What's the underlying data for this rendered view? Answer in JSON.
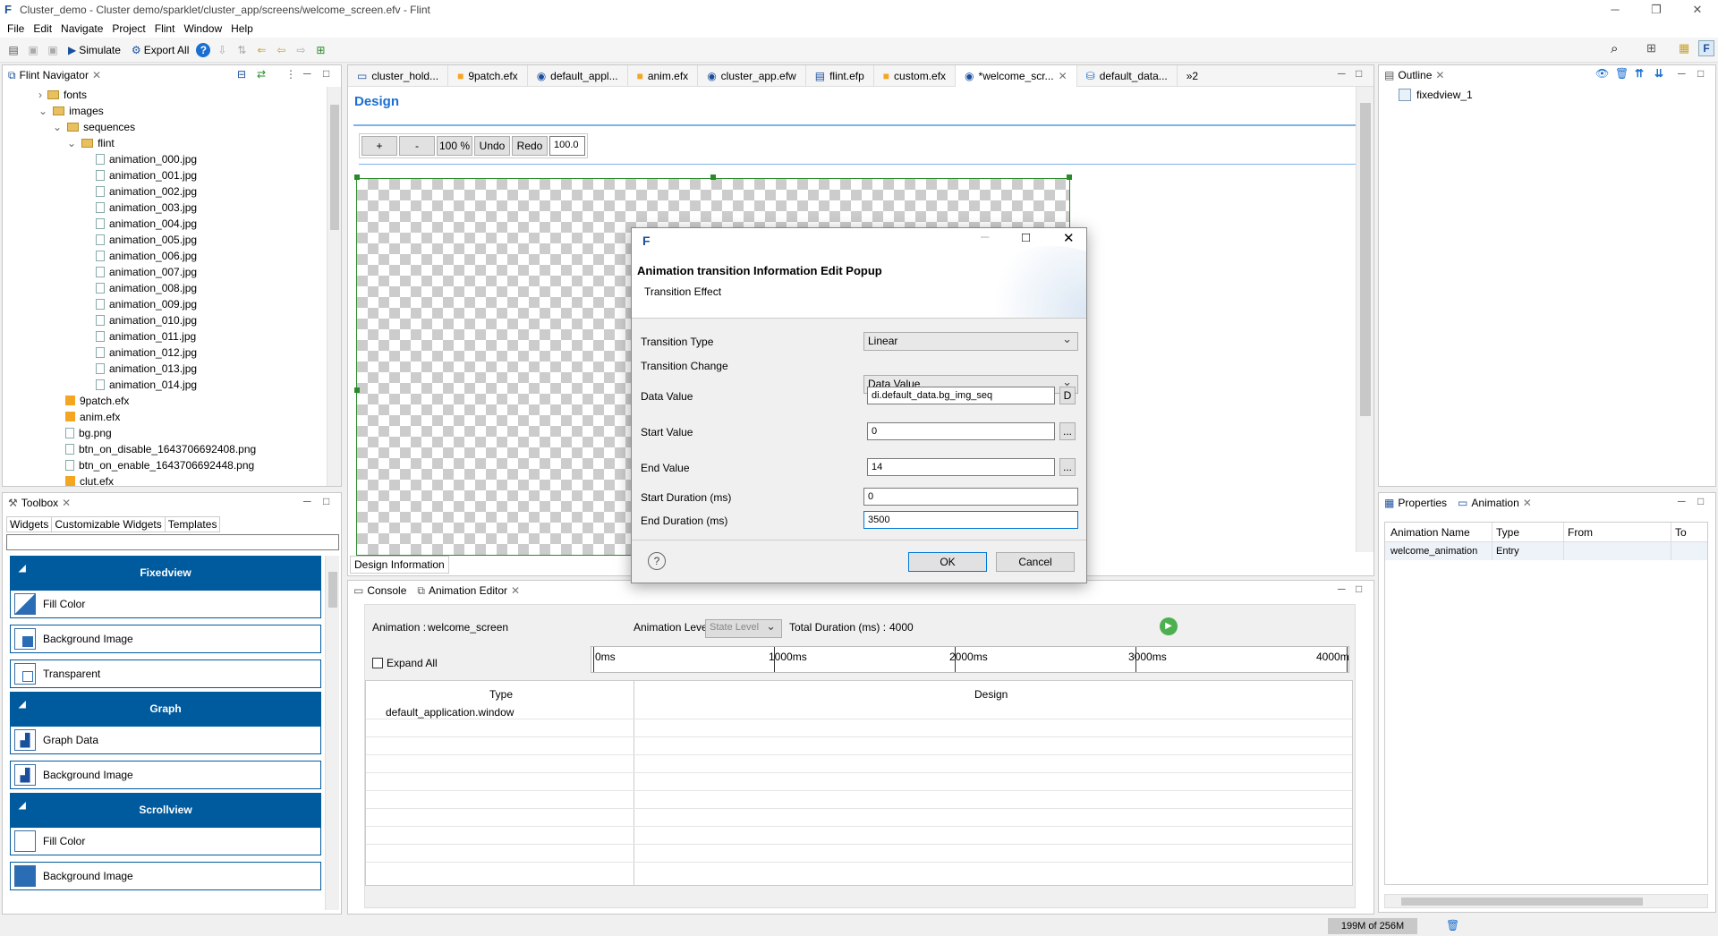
{
  "window": {
    "title": "Cluster_demo - Cluster demo/sparklet/cluster_app/screens/welcome_screen.efv - Flint",
    "app_icon": "F"
  },
  "menu": [
    "File",
    "Edit",
    "Navigate",
    "Project",
    "Flint",
    "Window",
    "Help"
  ],
  "toolbar": {
    "simulate": "Simulate",
    "export_all": "Export All"
  },
  "navigator": {
    "tab": "Flint Navigator",
    "folders": {
      "fonts": "fonts",
      "images": "images",
      "sequences": "sequences",
      "flint": "flint"
    },
    "anim_files": [
      "animation_000.jpg",
      "animation_001.jpg",
      "animation_002.jpg",
      "animation_003.jpg",
      "animation_004.jpg",
      "animation_005.jpg",
      "animation_006.jpg",
      "animation_007.jpg",
      "animation_008.jpg",
      "animation_009.jpg",
      "animation_010.jpg",
      "animation_011.jpg",
      "animation_012.jpg",
      "animation_013.jpg",
      "animation_014.jpg"
    ],
    "other_files": [
      "9patch.efx",
      "anim.efx",
      "bg.png",
      "btn_on_disable_1643706692408.png",
      "btn_on_enable_1643706692448.png",
      "clut.efx"
    ]
  },
  "toolbox": {
    "tab": "Toolbox",
    "subtabs": [
      "Widgets",
      "Customizable Widgets",
      "Templates"
    ],
    "groups": [
      {
        "title": "Fixedview",
        "items": [
          "Fill Color",
          "Background Image",
          "Transparent"
        ]
      },
      {
        "title": "Graph",
        "items": [
          "Graph Data",
          "Background Image"
        ]
      },
      {
        "title": "Scrollview",
        "items": [
          "Fill Color",
          "Background Image"
        ]
      }
    ]
  },
  "editor_tabs": [
    "cluster_hold...",
    "9patch.efx",
    "default_appl...",
    "anim.efx",
    "cluster_app.efw",
    "flint.efp",
    "custom.efx",
    "*welcome_scr...",
    "default_data..."
  ],
  "editor_overflow": "»2",
  "design": {
    "title": "Design",
    "zoom_plus": "+",
    "zoom_minus": "-",
    "zoom": "100 %",
    "undo": "Undo",
    "redo": "Redo",
    "zoom_value": "100.0",
    "info_tab": "Design Information"
  },
  "outline": {
    "tab": "Outline",
    "item": "fixedview_1"
  },
  "properties": {
    "tab1": "Properties",
    "tab2": "Animation",
    "columns": [
      "Animation Name",
      "Type",
      "From",
      "To"
    ],
    "rows": [
      {
        "name": "welcome_animation",
        "type": "Entry",
        "from": "",
        "to": ""
      }
    ]
  },
  "console": {
    "tab1": "Console",
    "tab2": "Animation Editor"
  },
  "anim_editor": {
    "animation_label": "Animation :",
    "animation_value": "welcome_screen",
    "level_label": "Animation Level :",
    "level_value": "State Level",
    "total_label": "Total Duration (ms) :",
    "total_value": "4000",
    "expand_all": "Expand All",
    "timeline": [
      "0ms",
      "1000ms",
      "2000ms",
      "3000ms",
      "4000m"
    ],
    "col_type": "Type",
    "col_design": "Design",
    "row1": "default_application.window"
  },
  "dialog": {
    "title": "Animation transition Information Edit Popup",
    "subtitle": "Transition Effect",
    "fields": {
      "transition_type_label": "Transition Type",
      "transition_type_value": "Linear",
      "transition_change_label": "Transition Change",
      "transition_change_value": "Data Value",
      "data_value_label": "Data Value",
      "data_value_value": "di.default_data.bg_img_seq",
      "data_value_btn": "D",
      "start_value_label": "Start Value",
      "start_value_value": "0",
      "start_value_btn": "...",
      "end_value_label": "End Value",
      "end_value_value": "14",
      "end_value_btn": "...",
      "start_duration_label": "Start Duration (ms)",
      "start_duration_value": "0",
      "end_duration_label": "End Duration (ms)",
      "end_duration_value": "3500"
    },
    "ok": "OK",
    "cancel": "Cancel",
    "help": "?"
  },
  "status": {
    "memory": "199M of 256M"
  }
}
